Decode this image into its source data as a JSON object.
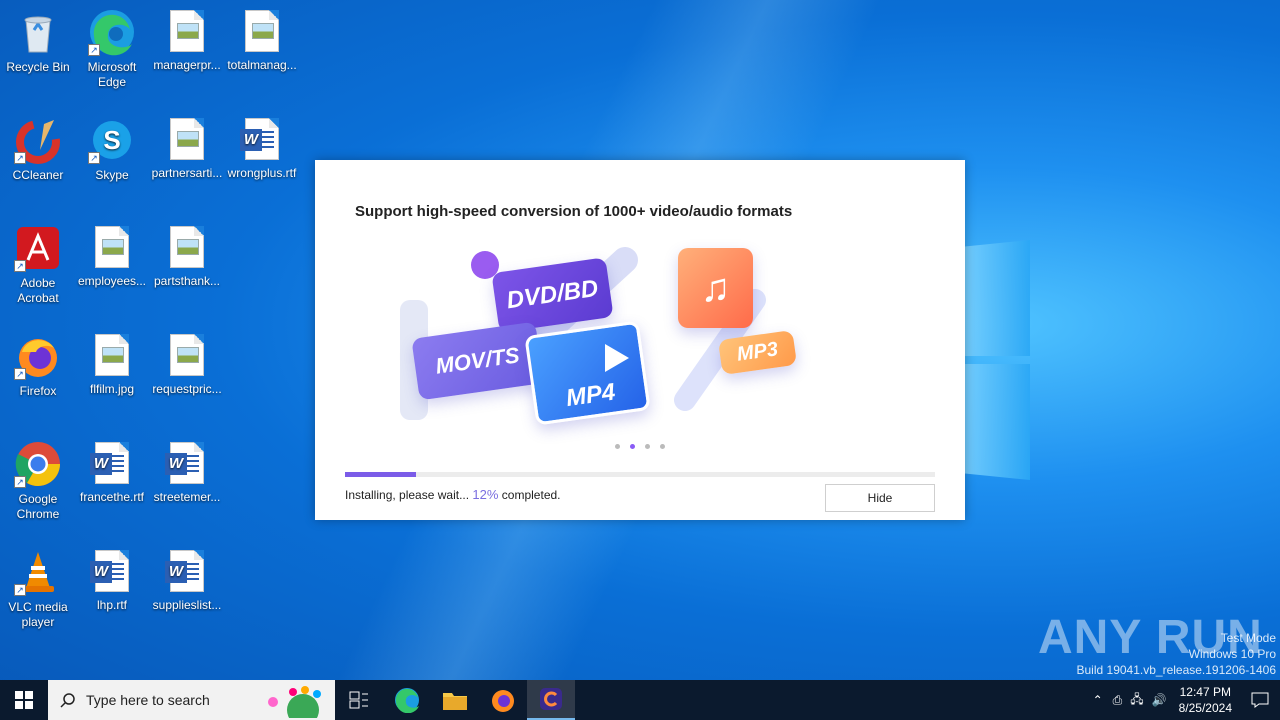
{
  "desktop": {
    "icons": [
      {
        "label": "Recycle Bin"
      },
      {
        "label": "Microsoft Edge"
      },
      {
        "label": "managerpr..."
      },
      {
        "label": "totalmanag..."
      },
      {
        "label": "CCleaner"
      },
      {
        "label": "Skype"
      },
      {
        "label": "partnersarti..."
      },
      {
        "label": "wrongplus.rtf"
      },
      {
        "label": "Adobe Acrobat"
      },
      {
        "label": "employees..."
      },
      {
        "label": "partsthank..."
      },
      {
        "label": "Firefox"
      },
      {
        "label": "flfilm.jpg"
      },
      {
        "label": "requestpric..."
      },
      {
        "label": "Google Chrome"
      },
      {
        "label": "francethe.rtf"
      },
      {
        "label": "streetemer..."
      },
      {
        "label": "VLC media player"
      },
      {
        "label": "lhp.rtf"
      },
      {
        "label": "supplieslist..."
      }
    ]
  },
  "dialog": {
    "title": "Support high-speed conversion of 1000+ video/audio formats",
    "banner": {
      "dvd": "DVD/BD",
      "mov": "MOV/TS",
      "mp4": "MP4",
      "mp3": "MP3"
    },
    "progress_fraction": 0.12,
    "status_prefix": "Installing, please wait...",
    "percent": "12%",
    "status_suffix": "completed.",
    "hide_label": "Hide",
    "accent": "#7b5ce8"
  },
  "watermark": {
    "brand": "ANY RUN",
    "mode": "Test Mode",
    "os": "Windows 10 Pro",
    "build": "Build 19041.vb_release.191206-1406"
  },
  "taskbar": {
    "search_placeholder": "Type here to search",
    "time": "12:47 PM",
    "date": "8/25/2024"
  }
}
